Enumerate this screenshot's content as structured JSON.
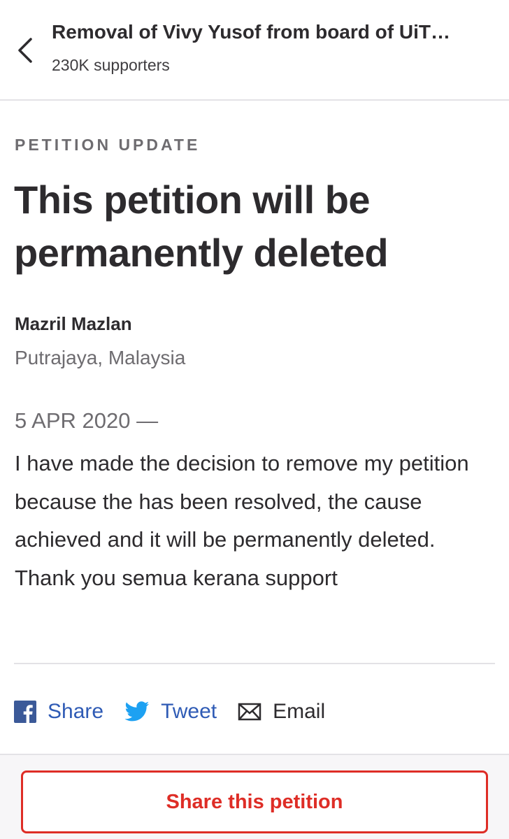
{
  "header": {
    "title": "Removal of Vivy Yusof from board of UiT…",
    "supporters": "230K supporters"
  },
  "update": {
    "eyebrow": "PETITION UPDATE",
    "headline": "This petition will be permanently deleted",
    "author": "Mazril Mazlan",
    "location": "Putrajaya, Malaysia",
    "date": "5 APR 2020 —",
    "body": "I have made the decision to remove my petition because the has been resolved, the cause achieved and it will be permanently deleted. Thank you semua kerana support"
  },
  "share": {
    "facebook_label": "Share",
    "twitter_label": "Tweet",
    "email_label": "Email",
    "facebook_icon": "facebook-icon",
    "twitter_icon": "twitter-icon",
    "email_icon": "email-icon"
  },
  "footer": {
    "button_label": "Share this petition"
  },
  "colors": {
    "accent_red": "#de2d26",
    "link_blue": "#2f5bb5",
    "facebook_blue": "#3b5998",
    "twitter_blue": "#1da1f2",
    "text_dark": "#2d2b2e",
    "text_muted": "#6e6c70"
  }
}
